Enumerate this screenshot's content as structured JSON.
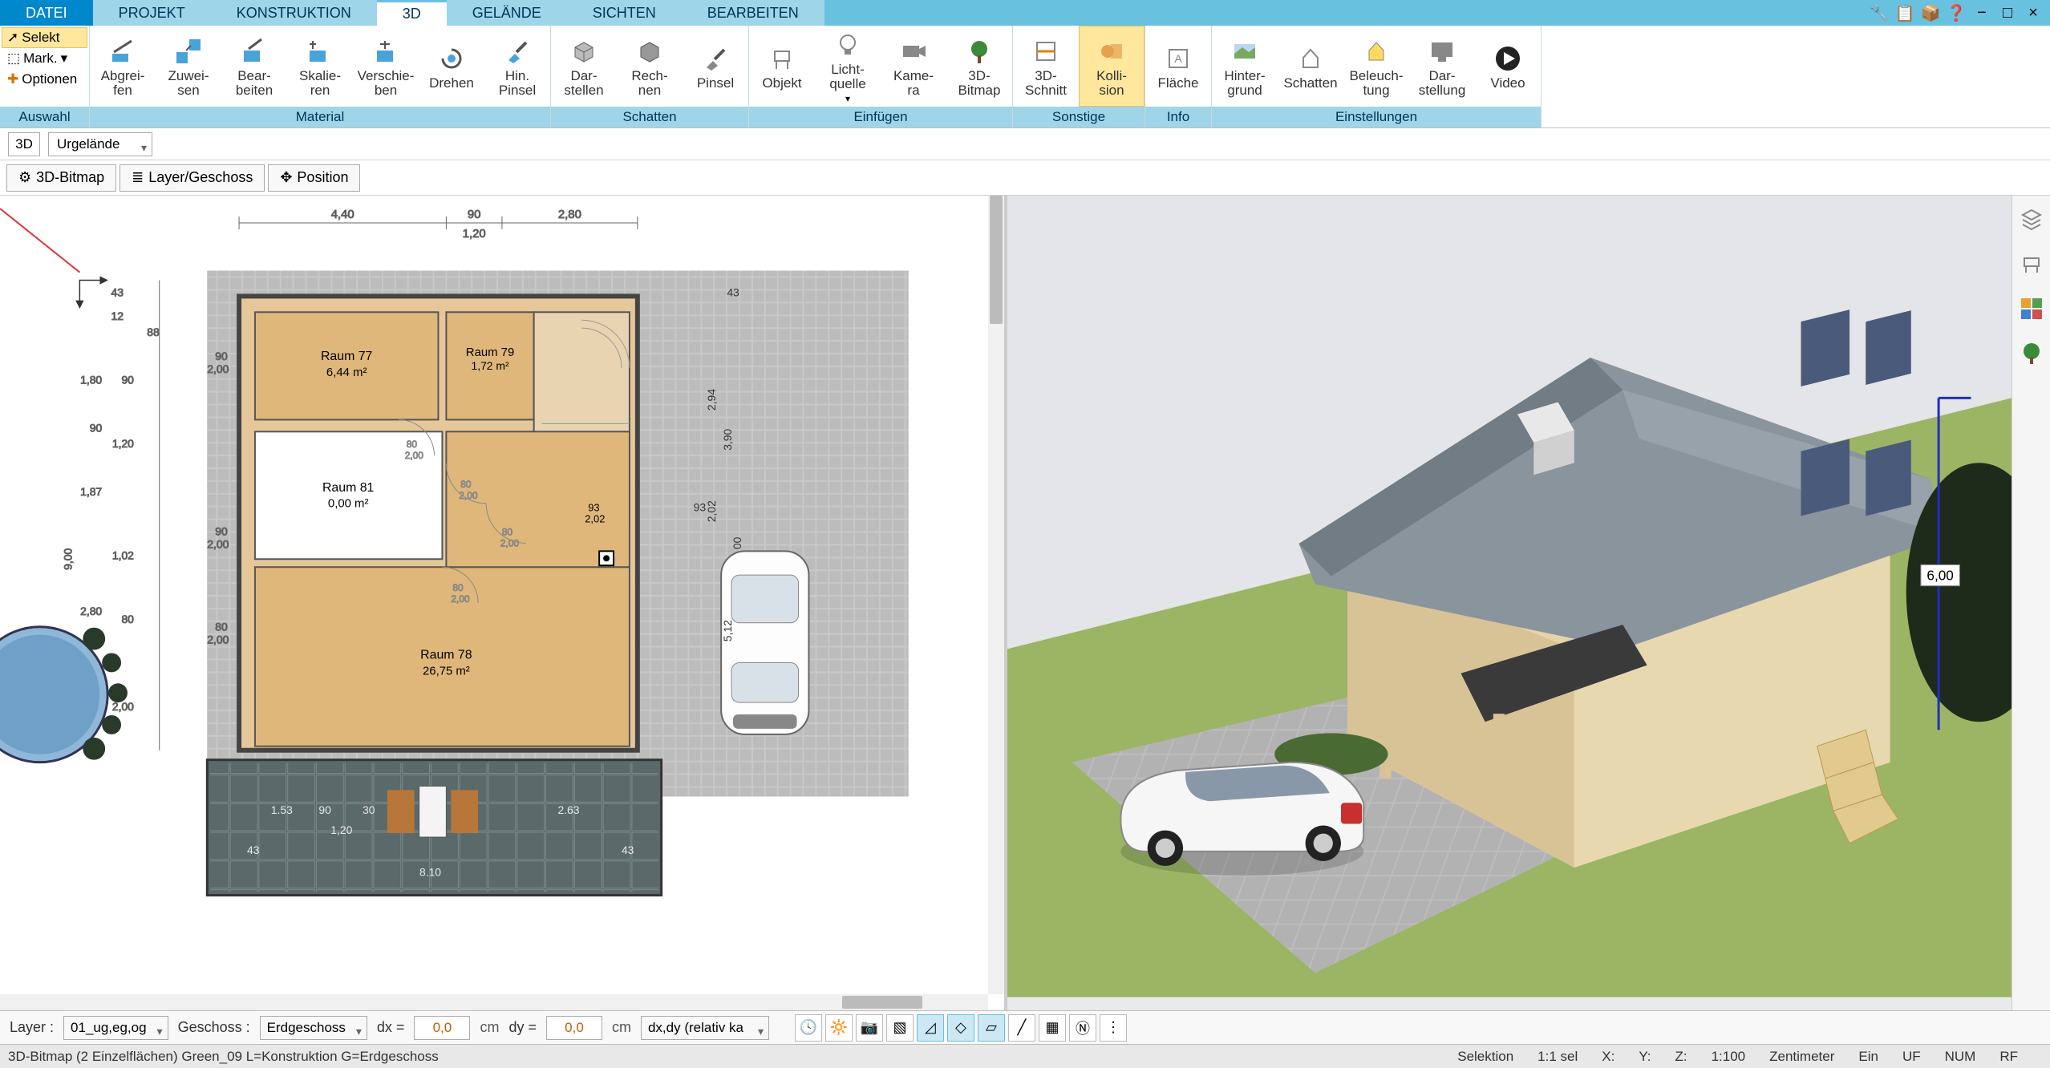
{
  "menu": {
    "tabs": [
      "DATEI",
      "PROJEKT",
      "KONSTRUKTION",
      "3D",
      "GELÄNDE",
      "SICHTEN",
      "BEARBEITEN"
    ],
    "active_index": 3
  },
  "ribbon": {
    "selection": {
      "selekt": "Selekt",
      "mark": "Mark.",
      "optionen": "Optionen",
      "group_label": "Auswahl"
    },
    "material": {
      "items": [
        {
          "label": "Abgrei-\nfen"
        },
        {
          "label": "Zuwei-\nsen"
        },
        {
          "label": "Bear-\nbeiten"
        },
        {
          "label": "Skalie-\nren"
        },
        {
          "label": "Verschie-\nben"
        },
        {
          "label": "Drehen"
        },
        {
          "label": "Hin.\nPinsel"
        }
      ],
      "group_label": "Material"
    },
    "schatten": {
      "items": [
        {
          "label": "Dar-\nstellen"
        },
        {
          "label": "Rech-\nnen"
        },
        {
          "label": "Pinsel"
        }
      ],
      "group_label": "Schatten"
    },
    "einfuegen": {
      "items": [
        {
          "label": "Objekt"
        },
        {
          "label": "Licht-\nquelle"
        },
        {
          "label": "Kame-\nra"
        },
        {
          "label": "3D-\nBitmap"
        }
      ],
      "group_label": "Einfügen"
    },
    "sonstige": {
      "items": [
        {
          "label": "3D-\nSchnitt"
        },
        {
          "label": "Kolli-\nsion",
          "active": true
        }
      ],
      "group_label": "Sonstige"
    },
    "info": {
      "items": [
        {
          "label": "Fläche"
        }
      ],
      "group_label": "Info"
    },
    "einstellungen": {
      "items": [
        {
          "label": "Hinter-\ngrund"
        },
        {
          "label": "Schatten"
        },
        {
          "label": "Beleuch-\ntung"
        },
        {
          "label": "Dar-\nstellung"
        },
        {
          "label": "Video"
        }
      ],
      "group_label": "Einstellungen"
    }
  },
  "subbar": {
    "mode": "3D",
    "terrain": "Urgelände",
    "btn_bitmap": "3D-Bitmap",
    "btn_layer": "Layer/Geschoss",
    "btn_position": "Position"
  },
  "plan": {
    "dim_top_a": "4,40",
    "dim_top_b": "90",
    "dim_top_c": "2,80",
    "dim_top_sub": "1,20",
    "room77": {
      "name": "Raum 77",
      "area": "6,44 m²"
    },
    "room79": {
      "name": "Raum 79",
      "area": "1,72 m²"
    },
    "room81": {
      "name": "Raum 81",
      "area": "0,00 m²"
    },
    "room78": {
      "name": "Raum 78",
      "area": "26,75 m²"
    },
    "left_outer": "9,00",
    "seg_180": "1,80",
    "seg_90": "90",
    "seg_187": "1,87",
    "seg_280": "2,80",
    "seg_102": "1,02",
    "seg_80": "80",
    "seg_200": "2,00",
    "seg_12": "12",
    "seg_43": "43",
    "seg_88": "88",
    "seg_120": "1,20",
    "r_93": "93",
    "r_294": "2,94",
    "r_390": "3,90",
    "r_202": "2,02",
    "r_512": "5,12",
    "r_00": "00",
    "b_153": "1.53",
    "b_90": "90",
    "b_30": "30",
    "b_263": "2.63",
    "b_120": "1,20",
    "b_810": "8.10",
    "b_43": "43",
    "d80": "80",
    "d200": "2,00",
    "d_93_2": "93",
    "d_202_2": "2,02"
  },
  "d3label": "6,00",
  "bottom": {
    "layer_label": "Layer :",
    "layer_value": "01_ug,eg,og",
    "geschoss_label": "Geschoss :",
    "geschoss_value": "Erdgeschoss",
    "dx_label": "dx =",
    "dx_value": "0,0",
    "dy_label": "dy =",
    "dy_value": "0,0",
    "unit": "cm",
    "mode": "dx,dy (relativ ka"
  },
  "status": {
    "left": "3D-Bitmap (2 Einzelflächen) Green_09 L=Konstruktion G=Erdgeschoss",
    "selektion": "Selektion",
    "sel": "1:1 sel",
    "x": "X:",
    "y": "Y:",
    "z": "Z:",
    "scale": "1:100",
    "unit": "Zentimeter",
    "ein": "Ein",
    "uf": "UF",
    "num": "NUM",
    "rf": "RF"
  }
}
